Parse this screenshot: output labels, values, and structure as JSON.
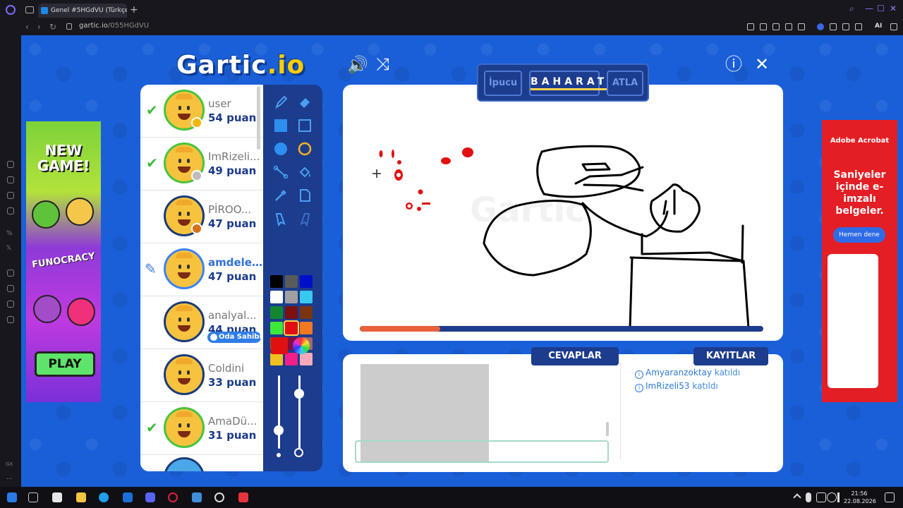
{
  "browser": {
    "tab_title": "Genel #5HGdVU (Türkçe)",
    "tab_close": "-",
    "new_tab": "+",
    "url_domain": "gartic.io",
    "url_path": "/055HGdVU",
    "ai_label": "AI",
    "sidebar_percent": "%",
    "sidebar_x": "𝕏",
    "sidebar_gx": "GX",
    "sidebar_more": "..."
  },
  "game": {
    "logo_text": "Gartic",
    "logo_suffix": ".io",
    "sound_icon": "🔊",
    "share_icon": "⤨",
    "info_icon": "ⓘ",
    "close_icon": "✕",
    "check_mark": "✔",
    "pencil_mark": "✎",
    "hint_button": "İpucu",
    "word": "BAHARAT",
    "skip_button": "ATLA",
    "answers_tab": "CEVAPLAR",
    "logs_tab": "KAYITLAR",
    "timer_progress": 0.2
  },
  "players": [
    {
      "name": "user",
      "score": "54 puan",
      "state": "guessed",
      "dot": "#f2b705"
    },
    {
      "name": "ImRizeli...",
      "score": "49 puan",
      "state": "guessed",
      "dot": "#bdbdbd"
    },
    {
      "name": "PİROO...",
      "score": "47 puan",
      "state": "none",
      "dot": "#d9701c"
    },
    {
      "name": "amdele...",
      "score": "47 puan",
      "state": "drawing",
      "dot": ""
    },
    {
      "name": "analyal...",
      "score": "44 puan",
      "state": "none",
      "dot": "",
      "badge": "Oda Sahibi"
    },
    {
      "name": "Coldini",
      "score": "33 puan",
      "state": "none",
      "dot": ""
    },
    {
      "name": "AmaDü...",
      "score": "31 puan",
      "state": "guessed",
      "dot": ""
    }
  ],
  "palette": {
    "colors": [
      "#000000",
      "#5a5a5a",
      "#0010c8",
      "#ffffff",
      "#a0a0a0",
      "#39c8f0",
      "#12862e",
      "#7a1010",
      "#7a3410",
      "#3de83d",
      "#e01010",
      "#f07820",
      "#a0601a",
      "#80103e",
      "#a06870",
      "#f0c020",
      "#f0208a",
      "#f4aab8"
    ],
    "selected_index": 10,
    "current_color": "#e01010",
    "slider_size": 0.25,
    "slider_opacity": 0.75
  },
  "logs": [
    {
      "user": "Amyaranzoktay",
      "text": "katıldı"
    },
    {
      "user": "ImRizeli53",
      "text": "katıldı"
    }
  ],
  "ad_left": {
    "title": "NEW GAME!",
    "brand": "FUNOCRACY",
    "play": "PLAY"
  },
  "ad_right": {
    "brand": "Adobe Acrobat",
    "headline": "Saniyeler içinde e-imzalı belgeler.",
    "button": "Hemen dene"
  },
  "taskbar": {
    "time": "21:56",
    "date": "22.08.2026"
  }
}
